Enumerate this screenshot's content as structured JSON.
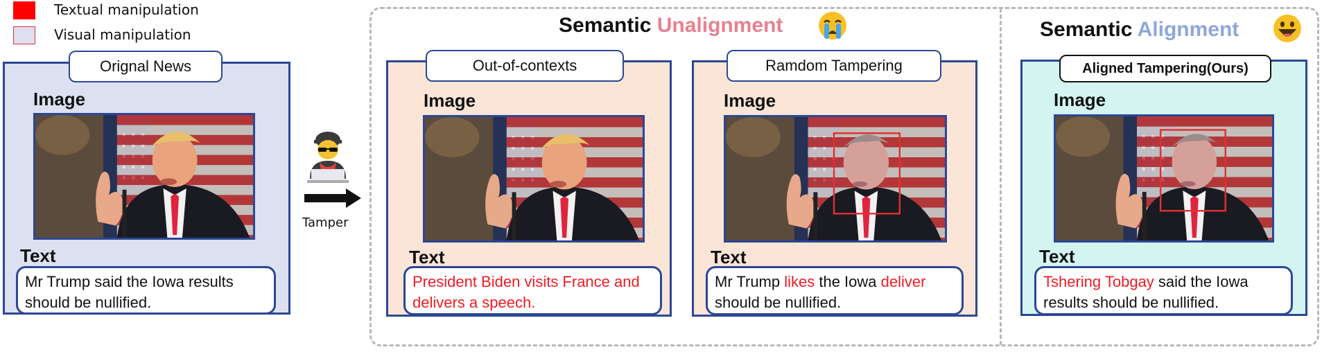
{
  "legend": {
    "textual_label": "Textual manipulation",
    "visual_label": "Visual manipulation",
    "textual_color": "#ff0000",
    "visual_color": "#dde0f0"
  },
  "tamper": {
    "label": "Tamper",
    "icon": "hacker-icon"
  },
  "groups": {
    "unalignment": {
      "prefix": "Semantic",
      "accent": "Unalignment",
      "accent_color": "#e8808f",
      "emoji": "crying-face-emoji"
    },
    "alignment": {
      "prefix": "Semantic",
      "accent": "Alignment",
      "accent_color": "#8fa6dc",
      "emoji": "grinning-face-emoji"
    }
  },
  "panels": {
    "original": {
      "title": "Orignal News",
      "image_heading": "Image",
      "text_heading": "Text",
      "text": "Mr Trump said the Iowa results should be nullified."
    },
    "out_of_context": {
      "title": "Out-of-contexts",
      "image_heading": "Image",
      "text_heading": "Text",
      "text": "President Biden visits France and delivers a speech."
    },
    "random": {
      "title": "Ramdom Tampering",
      "image_heading": "Image",
      "text_heading": "Text",
      "text_a": "Mr Trump ",
      "text_b": "likes",
      "text_c": " the Iowa ",
      "text_d": "deliver",
      "text_e": " should be nullified."
    },
    "aligned": {
      "title": "Aligned Tampering(Ours)",
      "image_heading": "Image",
      "text_heading": "Text",
      "text_a": "Tshering Tobgay",
      "text_b": " said the Iowa results should be nullified."
    }
  }
}
